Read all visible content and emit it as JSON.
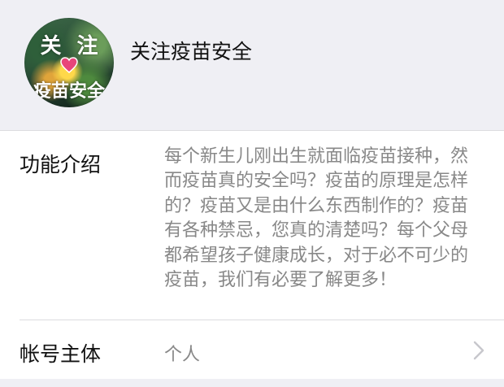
{
  "account": {
    "avatar": {
      "top_left": "关",
      "top_right": "注",
      "bottom": "疫苗安全",
      "heart_color": "#e8457a"
    },
    "name": "关注疫苗安全"
  },
  "profile": {
    "intro_label": "功能介绍",
    "intro_text": "每个新生儿刚出生就面临疫苗接种，然而疫苗真的安全吗？疫苗的原理是怎样的？疫苗又是由什么东西制作的？疫苗有各种禁忌，您真的清楚吗？每个父母都希望孩子健康成长，对于必不可少的疫苗，我们有必要了解更多！",
    "owner_label": "帐号主体",
    "owner_value": "个人",
    "owner_chevron_icon": "chevron-right-icon"
  },
  "colors": {
    "background": "#f2f2f5",
    "card": "#ffffff",
    "primary_text": "#111111",
    "secondary_text": "#888888",
    "divider": "#dcdcdf"
  }
}
